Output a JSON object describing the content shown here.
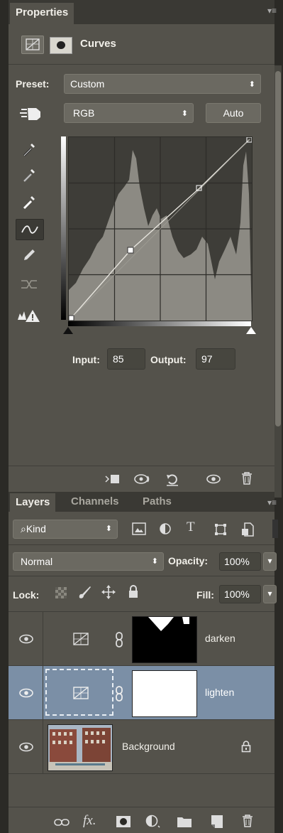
{
  "properties": {
    "tab_label": "Properties",
    "adjustment_title": "Curves",
    "preset_label": "Preset:",
    "preset_value": "Custom",
    "channel_value": "RGB",
    "auto_label": "Auto",
    "input_label": "Input:",
    "input_value": "85",
    "output_label": "Output:",
    "output_value": "97"
  },
  "layers_panel": {
    "tabs": [
      "Layers",
      "Channels",
      "Paths"
    ],
    "filter_kind": "Kind",
    "blend_mode": "Normal",
    "opacity_label": "Opacity:",
    "opacity_value": "100%",
    "lock_label": "Lock:",
    "fill_label": "Fill:",
    "fill_value": "100%",
    "layers": [
      {
        "name": "darken",
        "selected": false
      },
      {
        "name": "lighten",
        "selected": true
      },
      {
        "name": "Background",
        "selected": false
      }
    ]
  },
  "icons": [
    "curves-adjustment-icon",
    "mask-icon",
    "panel-menu-icon",
    "hand-target-icon",
    "black-eyedropper-icon",
    "gray-eyedropper-icon",
    "white-eyedropper-icon",
    "curve-point-icon",
    "pencil-icon",
    "smooth-icon",
    "clipping-warning-icon",
    "clip-to-layer-icon",
    "view-previous-icon",
    "reset-icon",
    "visibility-icon",
    "trash-icon",
    "image-filter-icon",
    "adjustment-filter-icon",
    "type-filter-icon",
    "shape-filter-icon",
    "smart-object-filter-icon",
    "lock-transparent-icon",
    "lock-paint-icon",
    "lock-move-icon",
    "lock-all-icon",
    "link-chain-icon",
    "link-layers-icon",
    "fx-icon",
    "add-mask-icon",
    "new-adjustment-icon",
    "new-group-icon",
    "new-layer-icon"
  ],
  "colors": {
    "panel": "#54524b",
    "selected_layer": "#7b8fa6",
    "background": "#2b2a26"
  }
}
